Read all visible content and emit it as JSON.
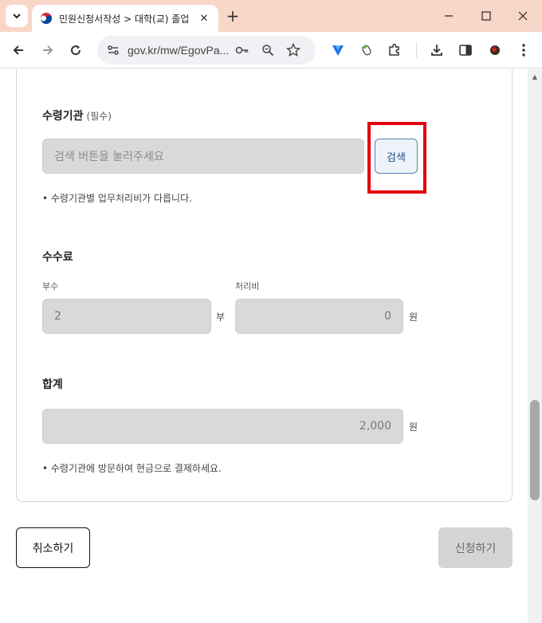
{
  "browser": {
    "tab_title": "민원신청서작성 > 대학(교) 졸업",
    "url": "gov.kr/mw/EgovPa...",
    "colors": {
      "titlebar": "#f8d7c8",
      "toolbar": "#ffffff"
    }
  },
  "form": {
    "recipient_org": {
      "title": "수령기관",
      "required": "(필수)",
      "placeholder": "검색 버튼을 눌러주세요",
      "search_button": "검색",
      "note": "• 수령기관별 업무처리비가 다릅니다."
    },
    "fee": {
      "title": "수수료",
      "copies_label": "부수",
      "copies_value": "2",
      "copies_unit": "부",
      "processing_label": "처리비",
      "processing_value": "0",
      "processing_unit": "원"
    },
    "total": {
      "title": "합계",
      "value": "2,000",
      "unit": "원",
      "note": "• 수령기관에 방문하여 현금으로 결제하세요."
    }
  },
  "actions": {
    "cancel": "취소하기",
    "submit": "신청하기"
  },
  "highlight": {
    "color": "#e3000f"
  }
}
